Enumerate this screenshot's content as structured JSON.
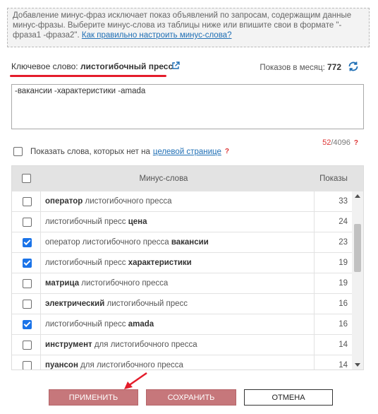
{
  "info": {
    "text": "Добавление минус-фраз исключает показ объявлений по запросам, содержащим данные минус-фразы. Выберите минус-слова из таблицы ниже или впишите свои в формате \"-фраза1 -фраза2\".",
    "link": "Как правильно настроить минус-слова?"
  },
  "keyword": {
    "label": "Ключевое слово:",
    "value": "листогибочный пресс",
    "external_icon": "external-link-icon"
  },
  "monthly": {
    "label": "Показов в месяц:",
    "value": "772",
    "refresh_icon": "refresh-icon"
  },
  "minus_phrases": {
    "value": "-вакансии -характеристики -amada"
  },
  "counter": {
    "used": "52",
    "limit": "/4096",
    "help": "?"
  },
  "show_missing": {
    "label": "Показать слова, которых нет на",
    "link": "целевой странице",
    "help": "?",
    "checked": false
  },
  "table": {
    "headers": {
      "words": "Минус-слова",
      "shows": "Показы"
    },
    "rows": [
      {
        "bold": "оператор",
        "rest": " листогибочного пресса",
        "bold_first": true,
        "shows": "33",
        "checked": false
      },
      {
        "bold": "цена",
        "rest": "листогибочный пресс ",
        "bold_first": false,
        "shows": "24",
        "checked": false
      },
      {
        "bold": "вакансии",
        "rest": "оператор листогибочного пресса ",
        "bold_first": false,
        "shows": "23",
        "checked": true
      },
      {
        "bold": "характеристики",
        "rest": "листогибочный пресс ",
        "bold_first": false,
        "shows": "19",
        "checked": true
      },
      {
        "bold": "матрица",
        "rest": " листогибочного пресса",
        "bold_first": true,
        "shows": "19",
        "checked": false
      },
      {
        "bold": "электрический",
        "rest": " листогибочный пресс",
        "bold_first": true,
        "shows": "16",
        "checked": false
      },
      {
        "bold": "amada",
        "rest": "листогибочный пресс ",
        "bold_first": false,
        "shows": "16",
        "checked": true
      },
      {
        "bold": "инструмент",
        "rest": " для листогибочного пресса",
        "bold_first": true,
        "shows": "14",
        "checked": false
      },
      {
        "bold": "пуансон",
        "rest": " для листогибочного пресса",
        "bold_first": true,
        "shows": "14",
        "checked": false
      }
    ]
  },
  "buttons": {
    "apply": "ПРИМЕНИТЬ",
    "save": "СОХРАНИТЬ",
    "cancel": "ОТМЕНА"
  },
  "colors": {
    "accent_red": "#e41c2b",
    "checkbox_blue": "#1a73e8",
    "button_rose": "#c6777b",
    "link_blue": "#1f6fb5"
  }
}
